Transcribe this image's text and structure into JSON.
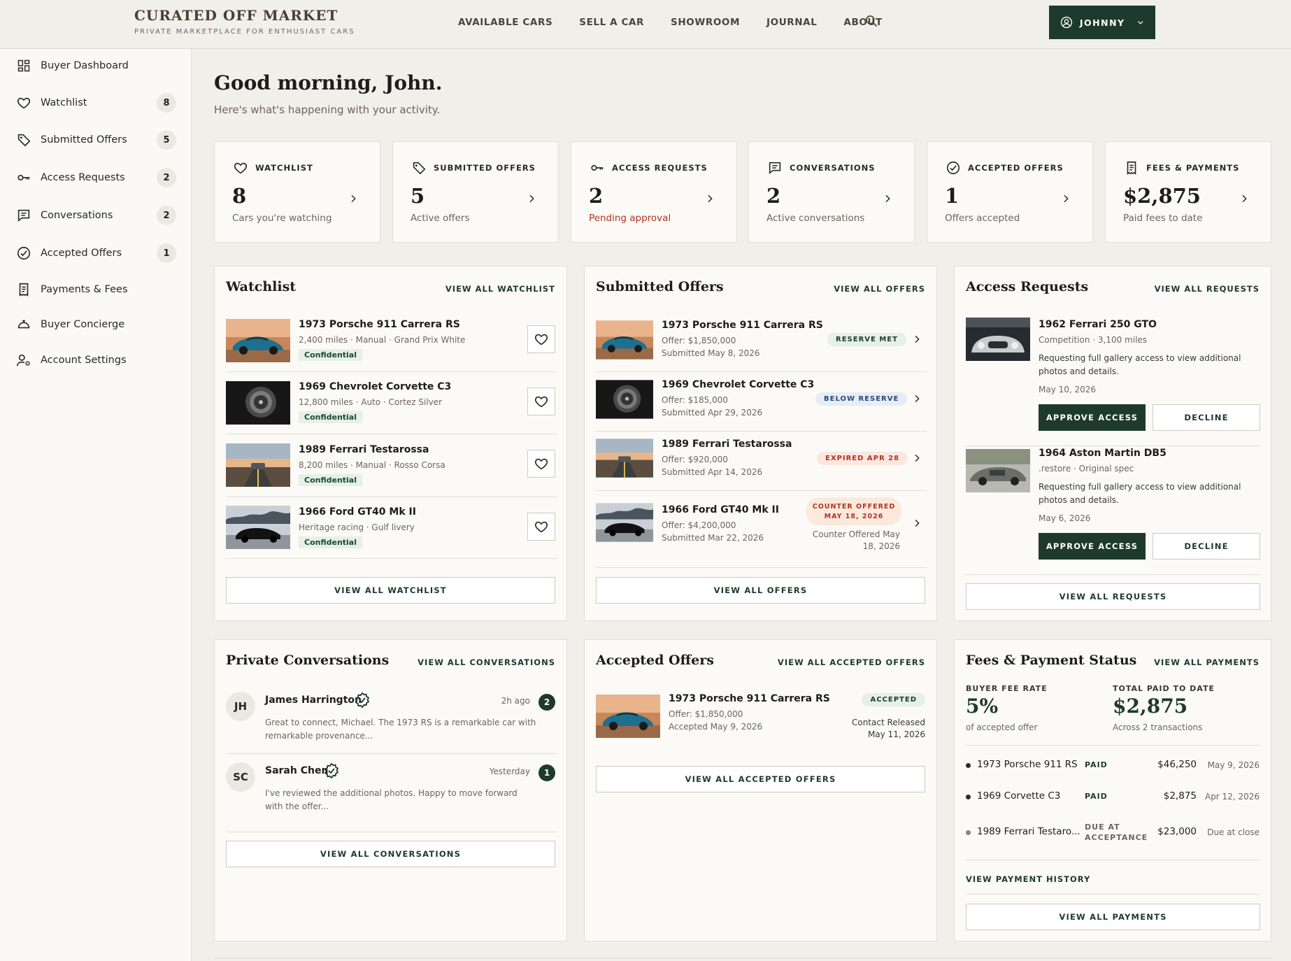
{
  "brand": {
    "title": "CURATED OFF MARKET",
    "tagline": "PRIVATE MARKETPLACE FOR ENTHUSIAST CARS"
  },
  "nav": [
    "AVAILABLE CARS",
    "SELL A CAR",
    "SHOWROOM",
    "JOURNAL",
    "ABOUT"
  ],
  "user": {
    "name": "JOHNNY"
  },
  "sidebar": [
    {
      "label": "Buyer Dashboard",
      "icon": "dashboard-icon",
      "count": ""
    },
    {
      "label": "Watchlist",
      "icon": "heart-icon",
      "count": "8"
    },
    {
      "label": "Submitted Offers",
      "icon": "tag-icon",
      "count": "5"
    },
    {
      "label": "Access Requests",
      "icon": "key-icon",
      "count": "2"
    },
    {
      "label": "Conversations",
      "icon": "chat-icon",
      "count": "2"
    },
    {
      "label": "Accepted Offers",
      "icon": "check-circle-icon",
      "count": "1"
    },
    {
      "label": "Payments & Fees",
      "icon": "receipt-icon",
      "count": ""
    },
    {
      "label": "Buyer Concierge",
      "icon": "concierge-icon",
      "count": ""
    },
    {
      "label": "Account Settings",
      "icon": "user-settings-icon",
      "count": ""
    }
  ],
  "greeting": "Good morning, John.",
  "subtitle": "Here's what's happening with your activity.",
  "stats": [
    {
      "title": "WATCHLIST",
      "value": "8",
      "desc": "Cars you're watching"
    },
    {
      "title": "SUBMITTED OFFERS",
      "value": "5",
      "desc": "Active offers"
    },
    {
      "title": "ACCESS REQUESTS",
      "value": "2",
      "desc": "Pending approval"
    },
    {
      "title": "CONVERSATIONS",
      "value": "2",
      "desc": "Active conversations"
    },
    {
      "title": "ACCEPTED OFFERS",
      "value": "1",
      "desc": "Offers accepted"
    },
    {
      "title": "FEES & PAYMENTS",
      "value": "$2,875",
      "desc": "Paid fees to date"
    }
  ],
  "watchlist": {
    "title": "Watchlist",
    "link": "VIEW ALL WATCHLIST",
    "button": "VIEW ALL WATCHLIST",
    "items": [
      {
        "name": "1973 Porsche 911 Carrera RS",
        "meta": "2,400 miles · Manual · Grand Prix White",
        "tag": "Confidential"
      },
      {
        "name": "1969 Chevrolet Corvette C3",
        "meta": "12,800 miles · Auto · Cortez Silver",
        "tag": "Confidential"
      },
      {
        "name": "1989 Ferrari Testarossa",
        "meta": "8,200 miles · Manual · Rosso Corsa",
        "tag": "Confidential"
      },
      {
        "name": "1966 Ford GT40 Mk II",
        "meta": "Heritage racing · Gulf livery",
        "tag": "Confidential"
      }
    ]
  },
  "offers": {
    "title": "Submitted Offers",
    "link": "VIEW ALL OFFERS",
    "button": "VIEW ALL OFFERS",
    "items": [
      {
        "name": "1973 Porsche 911 Carrera RS",
        "offer": "Offer: $1,850,000",
        "date": "Submitted May 8, 2026",
        "status": "RESERVE MET"
      },
      {
        "name": "1969 Chevrolet Corvette C3",
        "offer": "Offer: $185,000",
        "date": "Submitted Apr 29, 2026",
        "status": "BELOW RESERVE"
      },
      {
        "name": "1989 Ferrari Testarossa",
        "offer": "Offer: $920,000",
        "date": "Submitted Apr 14, 2026",
        "status": "EXPIRED APR 28"
      },
      {
        "name": "1966 Ford GT40 Mk II",
        "offer": "Offer: $4,200,000",
        "date": "Submitted Mar 22, 2026",
        "status1": "COUNTER OFFERED",
        "status2": "MAY 18, 2026",
        "note1": "Counter Offered May",
        "note2": "18, 2026"
      }
    ]
  },
  "access": {
    "title": "Access Requests",
    "link": "VIEW ALL REQUESTS",
    "button": "VIEW ALL REQUESTS",
    "approve": "APPROVE ACCESS",
    "decline": "DECLINE",
    "items": [
      {
        "name": "1962 Ferrari 250 GTO",
        "meta": "Competition · 3,100 miles",
        "desc1": "Requesting full gallery access to view additional",
        "desc2": "photos and details.",
        "date": "May 10, 2026"
      },
      {
        "name": "1964 Aston Martin DB5",
        "meta": ".restore · Original spec",
        "desc1": "Requesting full gallery access to view additional",
        "desc2": "photos and details.",
        "date": "May 6, 2026"
      }
    ]
  },
  "conversations": {
    "title": "Private Conversations",
    "link": "VIEW ALL CONVERSATIONS",
    "button": "VIEW ALL CONVERSATIONS",
    "items": [
      {
        "initials": "JH",
        "name": "James Harrington",
        "time": "2h ago",
        "unread": "2",
        "msg1": "Great to connect, Michael. The 1973 RS is a remarkable car with",
        "msg2": "remarkable provenance..."
      },
      {
        "initials": "SC",
        "name": "Sarah Chen",
        "time": "Yesterday",
        "unread": "1",
        "msg1": "I've reviewed the additional photos. Happy to move forward",
        "msg2": "with the offer..."
      }
    ]
  },
  "accepted": {
    "title": "Accepted Offers",
    "link": "VIEW ALL ACCEPTED OFFERS",
    "button": "VIEW ALL ACCEPTED OFFERS",
    "item": {
      "name": "1973 Porsche 911 Carrera RS",
      "offer": "Offer: $1,850,000",
      "date": "Accepted May 9, 2026",
      "status": "ACCEPTED",
      "note1": "Contact Released",
      "note2": "May 11, 2026"
    }
  },
  "fees": {
    "title": "Fees & Payment Status",
    "link": "VIEW ALL PAYMENTS",
    "rate_label": "BUYER FEE RATE",
    "rate": "5%",
    "rate_desc": "of accepted offer",
    "total_label": "TOTAL PAID TO DATE",
    "total": "$2,875",
    "total_desc": "Across 2 transactions",
    "rows": [
      {
        "car": "1973 Porsche 911 RS",
        "status": "PAID",
        "amount": "$46,250",
        "date": "May 9, 2026"
      },
      {
        "car": "1969 Corvette C3",
        "status": "PAID",
        "amount": "$2,875",
        "date": "Apr 12, 2026"
      },
      {
        "car": "1989 Ferrari Testaro...",
        "status1": "DUE AT",
        "status2": "ACCEPTANCE",
        "amount": "$23,000",
        "date": "Due at close"
      }
    ],
    "history": "VIEW PAYMENT HISTORY",
    "button": "VIEW ALL PAYMENTS"
  },
  "colors": {
    "accent": "#1e3a2e",
    "warn": "#b5331e",
    "bg": "#f1efea"
  }
}
